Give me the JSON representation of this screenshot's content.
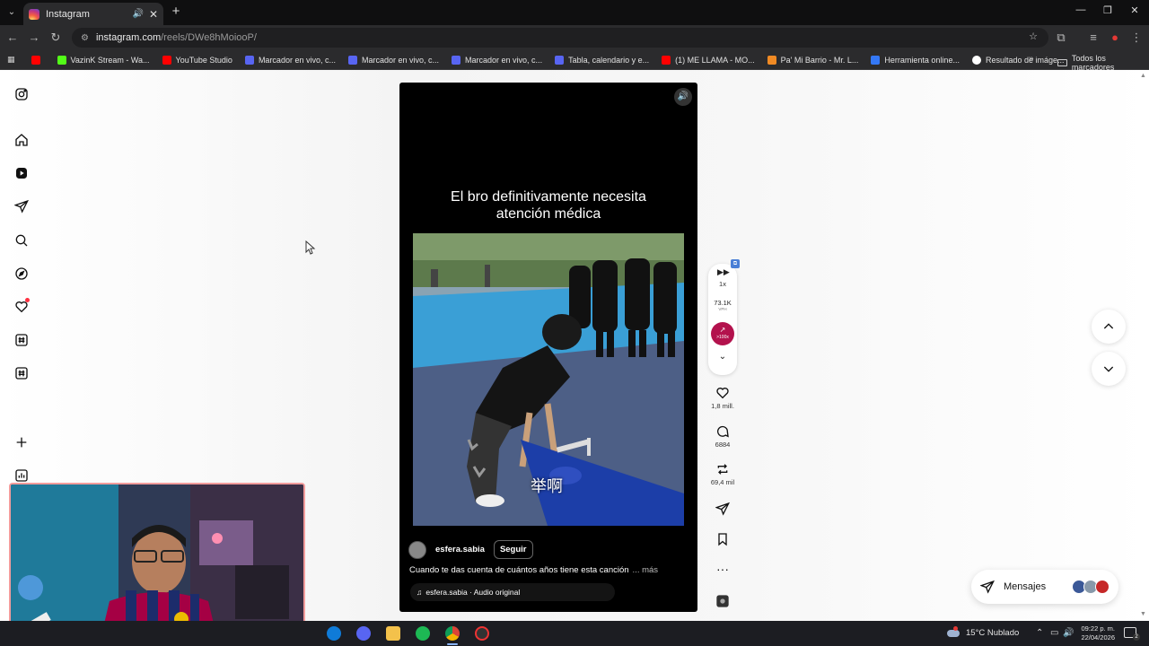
{
  "browser": {
    "tab_title": "Instagram",
    "url_host": "instagram.com",
    "url_path": "/reels/DWe8hMoiooP/",
    "bookmarks": [
      {
        "label": "",
        "color": "#ff0000"
      },
      {
        "label": "VazinK Stream - Wa...",
        "color": "#53fc18"
      },
      {
        "label": "YouTube Studio",
        "color": "#ff0000"
      },
      {
        "label": "Marcador en vivo, c...",
        "color": "#5865f2"
      },
      {
        "label": "Marcador en vivo, c...",
        "color": "#5865f2"
      },
      {
        "label": "Marcador en vivo, c...",
        "color": "#5865f2"
      },
      {
        "label": "Tabla, calendario y e...",
        "color": "#5865f2"
      },
      {
        "label": "(1) ME LLAMA - MO...",
        "color": "#ff0000"
      },
      {
        "label": "Pa' Mi Barrio - Mr. L...",
        "color": "#f08a24"
      },
      {
        "label": "Herramienta online...",
        "color": "#3478f6"
      },
      {
        "label": "Resultado de imáge...",
        "color": "#ffffff"
      }
    ],
    "all_bookmarks": "Todos los marcadores"
  },
  "reel": {
    "caption_line1": "El bro definitivamente necesita",
    "caption_line2": "atención médica",
    "video_subtitle": "举啊",
    "username": "esfera.sabia",
    "follow_label": "Seguir",
    "description": "Cuando te das cuenta de cuántos años tiene esta canción",
    "more_label": "... más",
    "audio_label": "esfera.sabia · Audio original"
  },
  "side_panel": {
    "speed": "1x",
    "views_per_hour": "73.1K",
    "vph_label": "VPH",
    "growth_label": ">100x"
  },
  "actions": {
    "likes": "1,8 mill.",
    "comments": "6884",
    "reposts": "69,4 mil"
  },
  "messages": {
    "label": "Mensajes",
    "avatar_colors": [
      "#3b5998",
      "#8899aa",
      "#c62828"
    ]
  },
  "taskbar": {
    "weather": "15°C  Nublado",
    "time": "09:22 p. m.",
    "date": "22/04/2026",
    "notification_count": "2"
  },
  "theme": {
    "accent_growth": "#b3124d",
    "notification_dot": "#ff3040"
  }
}
